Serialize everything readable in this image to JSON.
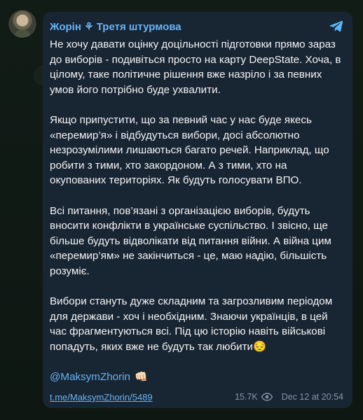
{
  "channel": {
    "name": "Жорін ⚘ Третя штурмова"
  },
  "message": {
    "paragraphs": [
      "Не хочу давати оцінку доцільності підготовки прямо зараз до виборів - подивіться просто на карту DeepState. Хоча, в цілому, таке політичне рішення вже назріло і за певних умов його потрібно буде ухвалити.",
      "Якщо припустити, що за певний час у нас буде якесь «перемир’я» і відбудуться вибори, досі абсолютно незрозумілими лишаються багато речей. Наприклад, що робити з тими, хто закордоном. А з тими, хто на окупованих територіях. Як будуть голосувати ВПО.",
      "Всі питання, пов’язані з організацією виборів, будуть вносити конфлікти в українське суспільство. І звісно, ще більше будуть відволікати від питання війни. А війна цим «перемир’ям» не закінчиться - це, маю надію, більшість розуміє.",
      "Вибори стануть дуже складним та загрозливим періодом для держави - хоч і необхідним. Знаючи українців, в цей час фрагментуються всі. Під цю історію навіть військові попадуть, яких вже не будуть так любити😔"
    ],
    "signature": "@MaksymZhorin",
    "signature_emoji": "👊🏻"
  },
  "footer": {
    "link": "t.me/MaksymZhorin/5489",
    "views": "15.7K",
    "date": "Dec 12 at 20:54"
  },
  "colors": {
    "bubble": "#182533",
    "accent": "#6ab3f3",
    "text": "#f5f5f5",
    "meta": "#8596a8",
    "telegram": "#5eb5f7"
  },
  "icons": {
    "brand": "telegram-icon",
    "views": "eye-icon"
  }
}
